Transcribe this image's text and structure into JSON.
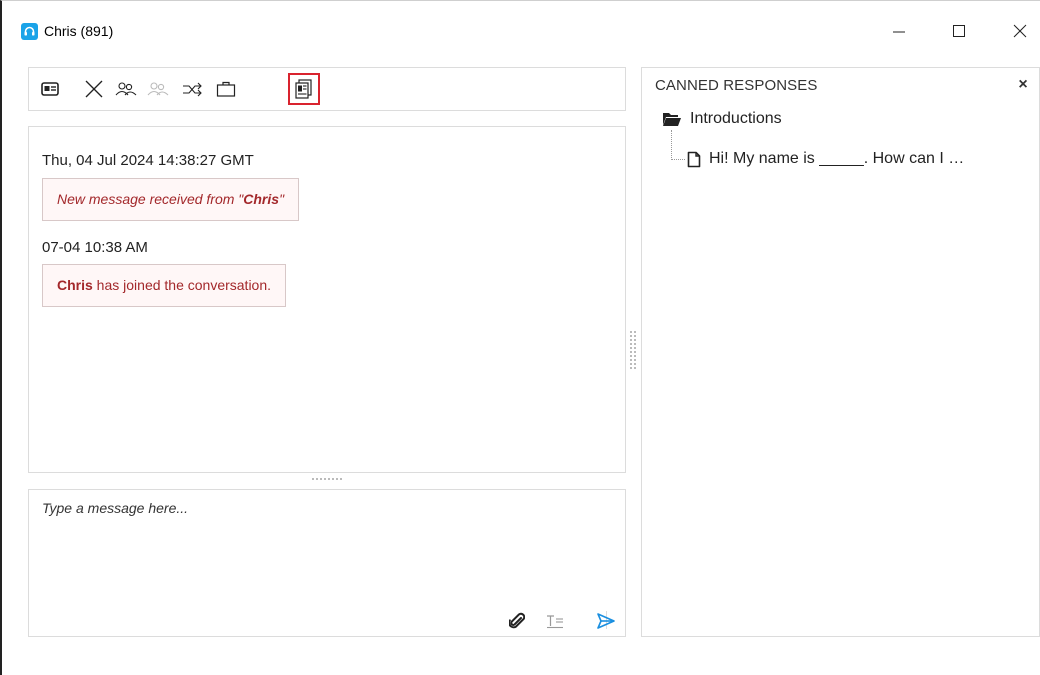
{
  "window": {
    "title": "Chris (891)",
    "controls": {
      "minimize_icon": "minimize-icon",
      "maximize_icon": "maximize-icon",
      "close_icon": "close-icon"
    }
  },
  "toolbar": {
    "buttons": [
      {
        "icon": "contact-card-icon",
        "enabled": true
      },
      {
        "icon": "end-chat-icon",
        "enabled": true
      },
      {
        "icon": "conference-icon",
        "enabled": true
      },
      {
        "icon": "conference-disabled-icon",
        "enabled": false
      },
      {
        "icon": "transfer-icon",
        "enabled": true
      },
      {
        "icon": "briefcase-icon",
        "enabled": true
      },
      {
        "icon": "canned-responses-icon",
        "enabled": true,
        "highlighted": true
      }
    ],
    "highlight_color": "#d9232e"
  },
  "chat": {
    "entries": [
      {
        "timestamp": "Thu, 04 Jul 2024 14:38:27 GMT",
        "prefix": "New message received from \"",
        "name": "Chris",
        "suffix": "\""
      },
      {
        "timestamp": "07-04 10:38 AM",
        "name": "Chris",
        "suffix": " has joined the conversation."
      }
    ],
    "message_color": "#a3282b"
  },
  "composer": {
    "placeholder": "Type a message here...",
    "value": "",
    "buttons": [
      "attach-icon",
      "text-format-icon",
      "send-icon"
    ],
    "send_color": "#1a8fe0"
  },
  "canned_responses": {
    "title": "CANNED RESPONSES",
    "close_label": "×",
    "folder": {
      "label": "Introductions",
      "icon": "folder-open-icon"
    },
    "items": [
      {
        "label": "Hi! My name is _____. How can I …",
        "icon": "document-icon"
      }
    ]
  }
}
